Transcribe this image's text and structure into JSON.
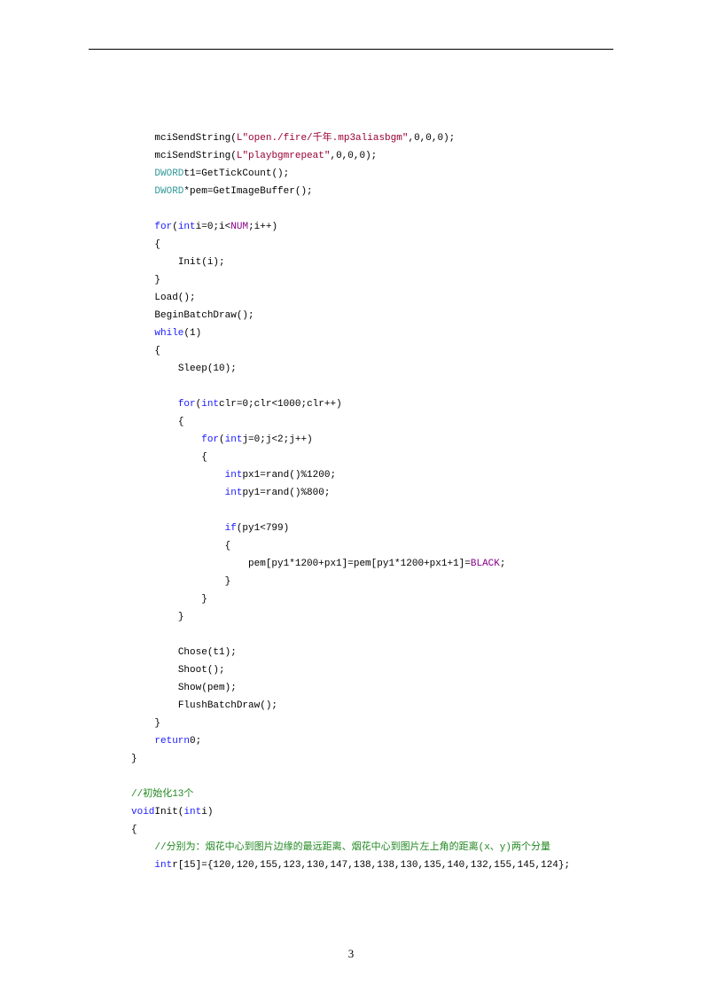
{
  "page_number": "3",
  "code": {
    "l1": {
      "fn": "mciSendString(",
      "l": "L",
      "str": "\"open./fire/千年.mp3aliasbgm\"",
      "rest": ",0,0,0);"
    },
    "l2": {
      "fn": "mciSendString(",
      "l": "L",
      "str": "\"playbgmrepeat\"",
      "rest": ",0,0,0);"
    },
    "l3": {
      "t": "DWORD",
      "rest": "t1=GetTickCount();"
    },
    "l4": {
      "t": "DWORD",
      "rest": "*pem=GetImageBuffer();"
    },
    "l5": {
      "kw": "for",
      "p1": "(",
      "kw2": "int",
      "p2": "i=0;i<",
      "mac": "NUM",
      "p3": ";i++)"
    },
    "l6": "{",
    "l7": "Init(i);",
    "l8": "}",
    "l9": "Load();",
    "l10": "BeginBatchDraw();",
    "l11": {
      "kw": "while",
      "rest": "(1)"
    },
    "l12": "{",
    "l13": "Sleep(10);",
    "l14": {
      "kw": "for",
      "p1": "(",
      "kw2": "int",
      "p2": "clr=0;clr<1000;clr++)"
    },
    "l15": "{",
    "l16": {
      "kw": "for",
      "p1": "(",
      "kw2": "int",
      "p2": "j=0;j<2;j++)"
    },
    "l17": "{",
    "l18": {
      "kw": "int",
      "rest": "px1=rand()%1200;"
    },
    "l19": {
      "kw": "int",
      "rest": "py1=rand()%800;"
    },
    "l20": {
      "kw": "if",
      "rest": "(py1<799)"
    },
    "l21": "{",
    "l22": {
      "pre": "pem[py1*1200+px1]=pem[py1*1200+px1+1]=",
      "mac": "BLACK",
      "post": ";"
    },
    "l23": "}",
    "l24": "}",
    "l25": "}",
    "l26": "Chose(t1);",
    "l27": "Shoot();",
    "l28": "Show(pem);",
    "l29": "FlushBatchDraw();",
    "l30": "}",
    "l31": {
      "kw": "return",
      "rest": "0;"
    },
    "l32": "}",
    "l33": "//初始化13个",
    "l34": {
      "kw": "void",
      "fn": "Init(",
      "kw2": "int",
      "rest": "i)"
    },
    "l35": "{",
    "l36": "//分别为：烟花中心到图片边缘的最远距离、烟花中心到图片左上角的距离(x、y)两个分量",
    "l37": {
      "kw": "int",
      "rest": "r[15]={120,120,155,123,130,147,138,138,130,135,140,132,155,145,124};"
    }
  }
}
